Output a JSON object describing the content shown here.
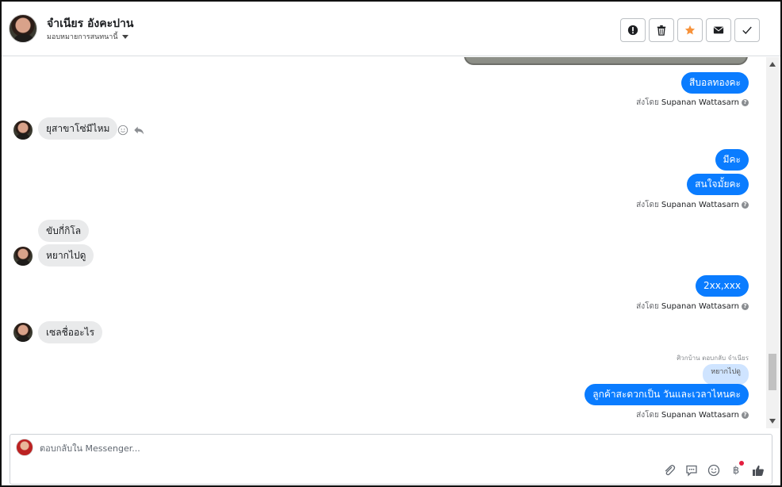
{
  "header": {
    "contact_name": "จำเนียร อังคะปาน",
    "assign_label": "มอบหมายการสนทนานี้",
    "actions": [
      {
        "name": "spam-button",
        "icon": "exclamation-icon"
      },
      {
        "name": "delete-button",
        "icon": "trash-icon"
      },
      {
        "name": "star-button",
        "icon": "star-icon",
        "color": "#f7923a"
      },
      {
        "name": "mark-unread-button",
        "icon": "envelope-icon"
      },
      {
        "name": "mark-done-button",
        "icon": "check-icon"
      }
    ]
  },
  "thread": {
    "messages": [
      {
        "dir": "out",
        "text": "สีบอลทองคะ"
      },
      {
        "dir": "in",
        "text": "ยุสาขาโซ่มีไหม"
      },
      {
        "dir": "out",
        "text": "มีคะ"
      },
      {
        "dir": "out",
        "text": "สนใจมั้ยคะ"
      },
      {
        "dir": "in",
        "text": "ขับกี่กิโล"
      },
      {
        "dir": "in",
        "text": "หยากไปดู"
      },
      {
        "dir": "out",
        "text": "2xx,xxx"
      },
      {
        "dir": "in",
        "text": "เซลชื่ออะไร"
      },
      {
        "dir": "out",
        "text": "ลูกค้าสะดวกเป็น วันและเวลาไหนคะ"
      }
    ],
    "sent_by_prefix": "ส่งโดย",
    "sent_by_name": "Supanan Wattasarn",
    "reply_meta": "ศิวกบ้าน ตอบกลับ จำเนียร",
    "quoted_text": "หยากไปดู"
  },
  "composer": {
    "placeholder": "ตอบกลับใน Messenger...",
    "tools": [
      "paperclip-icon",
      "saved-reply-icon",
      "emoji-icon",
      "baht-icon",
      "like-icon"
    ]
  },
  "colors": {
    "outgoing_bubble": "#0a7cff",
    "incoming_bubble": "#e9eaeb",
    "quote_bubble": "#cfe4ff",
    "notification_dot": "#e41e3f"
  }
}
